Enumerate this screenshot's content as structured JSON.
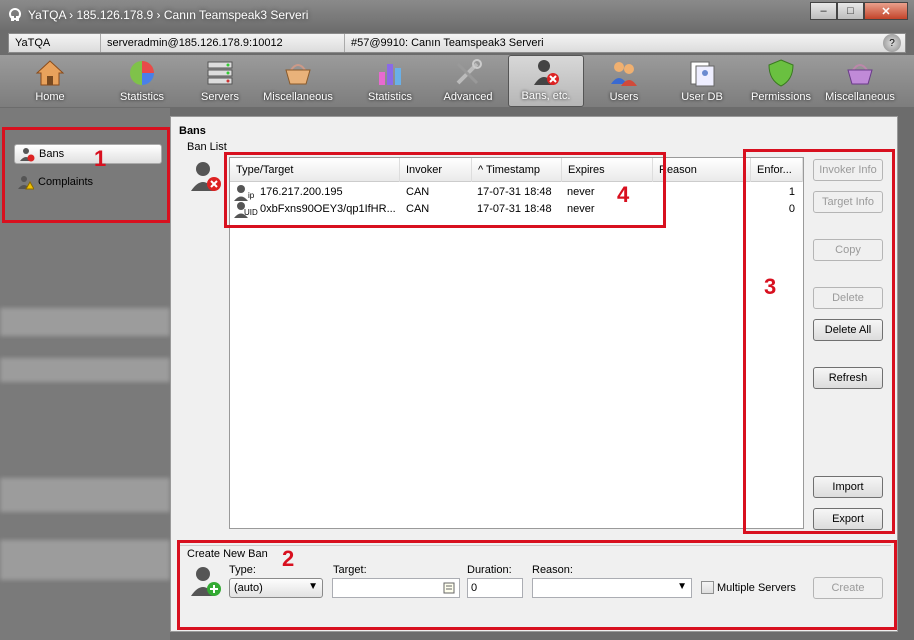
{
  "window": {
    "title": "YaTQA › 185.126.178.9 › Canın Teamspeak3 Serveri",
    "buttons": {
      "minimize": "‒",
      "maximize": "□",
      "close": "✕"
    }
  },
  "breadcrumb": {
    "items": [
      "YaTQA",
      "serveradmin@185.126.178.9:10012",
      "#57@9910: Canın Teamspeak3 Serveri"
    ],
    "help": "?"
  },
  "toolbar": {
    "items": [
      {
        "label": "Home",
        "icon": "home-icon"
      },
      {
        "label": "Statistics",
        "icon": "pie-chart-icon"
      },
      {
        "label": "Servers",
        "icon": "servers-icon"
      },
      {
        "label": "Miscellaneous",
        "icon": "basket-icon"
      },
      {
        "label": "Statistics",
        "icon": "bar-chart-icon"
      },
      {
        "label": "Advanced",
        "icon": "tools-icon"
      },
      {
        "label": "Bans, etc.",
        "icon": "ban-user-icon",
        "active": true
      },
      {
        "label": "Users",
        "icon": "users-icon"
      },
      {
        "label": "User DB",
        "icon": "user-db-icon"
      },
      {
        "label": "Permissions",
        "icon": "shield-icon"
      },
      {
        "label": "Miscellaneous",
        "icon": "basket-icon"
      }
    ]
  },
  "sidebar": {
    "items": [
      {
        "label": "Bans",
        "icon": "ban-user-icon",
        "selected": true
      },
      {
        "label": "Complaints",
        "icon": "warning-user-icon"
      }
    ]
  },
  "bans": {
    "title": "Bans",
    "list_label": "Ban List",
    "columns": [
      "Type/Target",
      "Invoker",
      "^ Timestamp",
      "Expires",
      "Reason",
      "Enfor..."
    ],
    "rows": [
      {
        "type": "ip",
        "target": "176.217.200.195",
        "invoker": "CAN",
        "timestamp": "17-07-31 18:48",
        "expires": "never",
        "reason": "",
        "enforcements": "1"
      },
      {
        "type": "UID",
        "target": "0xbFxns90OEY3/qp1IfHR...",
        "invoker": "CAN",
        "timestamp": "17-07-31 18:48",
        "expires": "never",
        "reason": "",
        "enforcements": "0"
      }
    ]
  },
  "actions": {
    "invoker_info": "Invoker Info",
    "target_info": "Target Info",
    "copy": "Copy",
    "delete": "Delete",
    "delete_all": "Delete All",
    "refresh": "Refresh",
    "import": "Import",
    "export": "Export"
  },
  "create_ban": {
    "title": "Create New Ban",
    "type_label": "Type:",
    "type_value": "(auto)",
    "target_label": "Target:",
    "target_value": "",
    "duration_label": "Duration:",
    "duration_value": "0",
    "reason_label": "Reason:",
    "reason_value": "",
    "multiple_servers_label": "Multiple Servers",
    "create_label": "Create"
  },
  "annotations": [
    "1",
    "2",
    "3",
    "4"
  ],
  "colors": {
    "annotation": "#d8101f",
    "toolbar": "#8a8a8a",
    "panel": "#f0f0f0"
  }
}
